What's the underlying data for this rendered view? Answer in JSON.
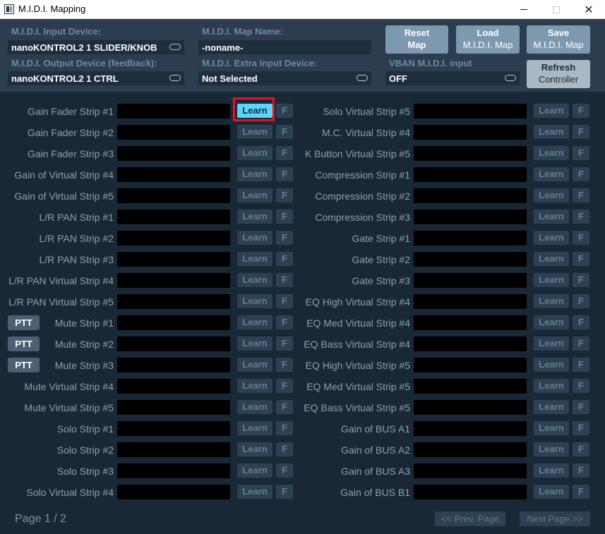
{
  "window": {
    "title": "M.I.D.I. Mapping",
    "close_glyph": "✕"
  },
  "header": {
    "input_device_label": "M.I.D.I. Input Device:",
    "input_device_value": "nanoKONTROL2 1 SLIDER/KNOB",
    "output_device_label": "M.I.D.I. Output Device (feedback):",
    "output_device_value": "nanoKONTROL2 1 CTRL",
    "map_name_label": "M.I.D.I. Map Name:",
    "map_name_value": "-noname-",
    "extra_input_label": "M.I.D.I. Extra Input Device:",
    "extra_input_value": "Not Selected",
    "vban_label": "VBAN M.I.D.I. input",
    "vban_value": "OFF",
    "reset_line1": "Reset",
    "reset_line2": "Map",
    "load_line1": "Load",
    "load_line2": "M.I.D.I. Map",
    "save_line1": "Save",
    "save_line2": "M.I.D.I. Map",
    "refresh_line1": "Refresh",
    "refresh_line2": "Controller"
  },
  "learn_label": "Learn",
  "f_label": "F",
  "ptt_label": "PTT",
  "left_rows": [
    {
      "label": "Gain Fader Strip #1",
      "active": true
    },
    {
      "label": "Gain Fader Strip #2"
    },
    {
      "label": "Gain Fader Strip #3"
    },
    {
      "label": "Gain of Virtual Strip #4"
    },
    {
      "label": "Gain of Virtual Strip #5"
    },
    {
      "label": "L/R PAN Strip #1"
    },
    {
      "label": "L/R PAN Strip #2"
    },
    {
      "label": "L/R PAN Strip #3"
    },
    {
      "label": "L/R PAN Virtual Strip #4"
    },
    {
      "label": "L/R PAN Virtual Strip #5"
    },
    {
      "label": "Mute Strip #1",
      "ptt": true
    },
    {
      "label": "Mute Strip #2",
      "ptt": true
    },
    {
      "label": "Mute Strip #3",
      "ptt": true
    },
    {
      "label": "Mute Virtual Strip #4"
    },
    {
      "label": "Mute Virtual Strip #5"
    },
    {
      "label": "Solo Strip #1"
    },
    {
      "label": "Solo Strip #2"
    },
    {
      "label": "Solo Strip #3"
    },
    {
      "label": "Solo Virtual Strip #4"
    }
  ],
  "right_rows": [
    {
      "label": "Solo Virtual Strip #5"
    },
    {
      "label": "M.C. Virtual Strip #4"
    },
    {
      "label": "K Button Virtual Strip #5"
    },
    {
      "label": "Compression Strip #1"
    },
    {
      "label": "Compression Strip #2"
    },
    {
      "label": "Compression Strip #3"
    },
    {
      "label": "Gate Strip #1"
    },
    {
      "label": "Gate Strip #2"
    },
    {
      "label": "Gate Strip #3"
    },
    {
      "label": "EQ High Virtual Strip #4"
    },
    {
      "label": "EQ Med Virtual Strip #4"
    },
    {
      "label": "EQ Bass Virtual Strip #4"
    },
    {
      "label": "EQ High Virtual Strip #5"
    },
    {
      "label": "EQ Med Virtual Strip #5"
    },
    {
      "label": "EQ Bass Virtual Strip #5"
    },
    {
      "label": "Gain of BUS A1"
    },
    {
      "label": "Gain of BUS A2"
    },
    {
      "label": "Gain of BUS A3"
    },
    {
      "label": "Gain of BUS B1"
    }
  ],
  "footer": {
    "page_label": "Page 1 / 2",
    "prev_label": "<< Prev. Page",
    "next_label": "Next Page >>"
  }
}
